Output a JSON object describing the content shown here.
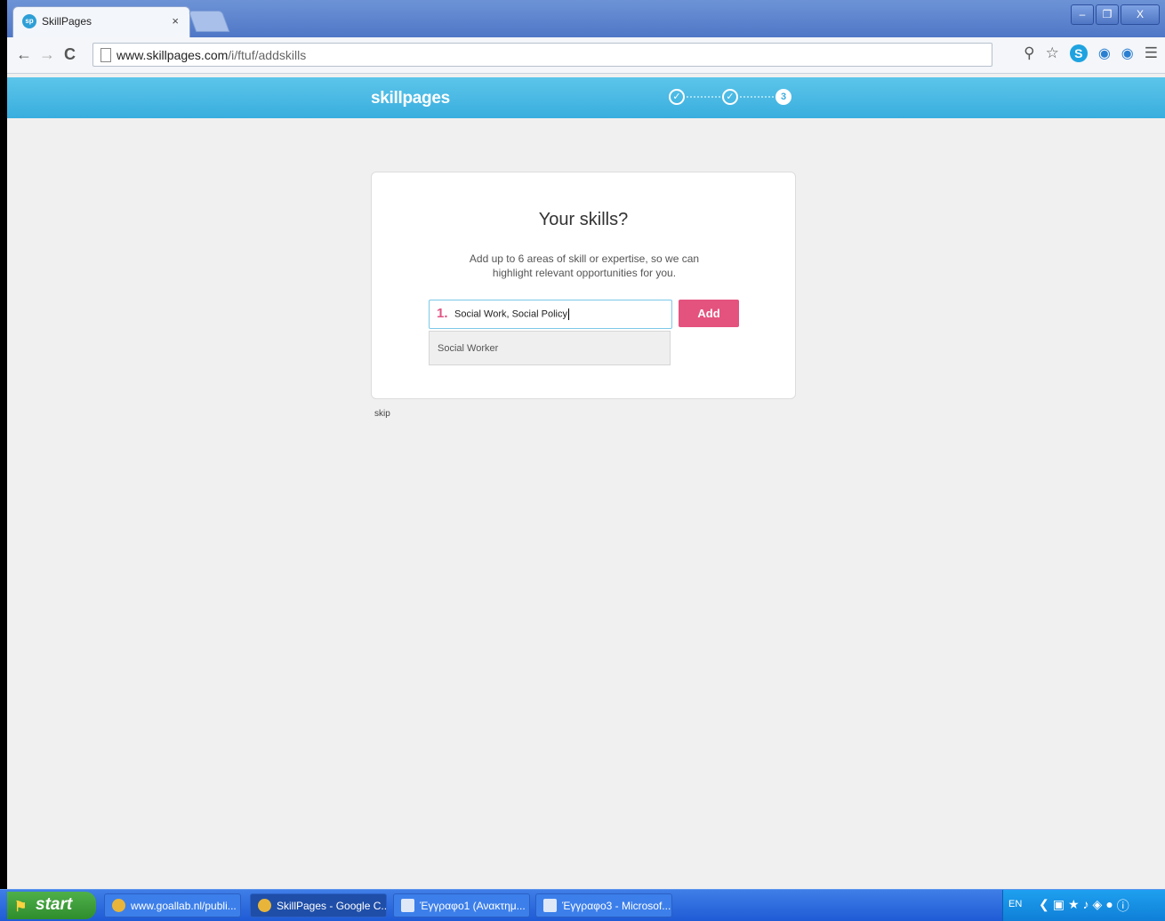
{
  "browser": {
    "tab_title": "SkillPages",
    "tab_favicon": "sp",
    "tab_close": "×",
    "url_host": "www.skillpages.com",
    "url_path": "/i/ftuf/addskills",
    "win_minimize": "–",
    "win_restore": "❐",
    "win_close": "X"
  },
  "site": {
    "brand": "skillpages",
    "steps": [
      "✓",
      "✓",
      "3"
    ],
    "accent_color": "#39aede",
    "button_color": "#e4527e"
  },
  "card": {
    "heading": "Your skills?",
    "description": "Add up to 6 areas of skill or expertise, so we can highlight relevant opportunities for you.",
    "input_number": "1.",
    "input_value": "Social Work, Social Policy",
    "add_label": "Add",
    "suggestion": "Social Worker",
    "skip": "skip"
  },
  "taskbar": {
    "start_label": "start",
    "tasks": [
      {
        "label": "www.goallab.nl/publi..."
      },
      {
        "label": "SkillPages - Google C..."
      },
      {
        "label": "Έγγραφο1 (Ανακτημ..."
      },
      {
        "label": "Έγγραφο3 - Microsof..."
      }
    ],
    "language": "EN"
  }
}
